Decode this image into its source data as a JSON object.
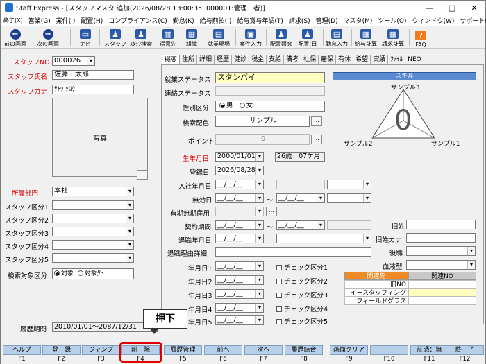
{
  "window": {
    "title": "Staff Express - [スタッフマスタ 追加(2026/08/28 13:00:35, 000001:管理　者)]",
    "minimize": "—",
    "maximize": "□",
    "close": "✕"
  },
  "menu": [
    "終了(X)",
    "営業(G)",
    "案件(J)",
    "配置(H)",
    "コンプライアンス(C)",
    "勤怠(K)",
    "給与前払(I)",
    "給与賞与年調(T)",
    "請求(S)",
    "管理(D)",
    "マスタ(M)",
    "ツール(O)",
    "ウィンドウ(W)",
    "サポート(H)"
  ],
  "toolbar": {
    "back": "前の画面",
    "forward": "次の画面",
    "navi": "ナビ",
    "staff": "スタッフ",
    "staff_search": "ｽﾀｯﾌ検索",
    "client": "得意先",
    "org": "組織",
    "site": "就業現場",
    "case_entry": "案件入力",
    "placement": "配置照会",
    "placement_day": "配置(日",
    "attendance": "勤怠入力",
    "pay_calc": "給与計算",
    "bill_calc": "請求計算",
    "faq": "FAQ"
  },
  "left": {
    "staff_no_label": "スタッフNO",
    "staff_no": "000026",
    "name_label": "スタッフ氏名",
    "name": "佐藤　太郎",
    "kana_label": "スタッフカナ",
    "kana": "ｻﾄｳ ｸﾛｳ",
    "photo": "写真",
    "photo_btn": "...",
    "dept_label": "所属部門",
    "dept": "本社",
    "class1": "スタッフ区分1",
    "class2": "スタッフ区分2",
    "class3": "スタッフ区分3",
    "class4": "スタッフ区分4",
    "class5": "スタッフ区分5",
    "search_label": "検索対象区分",
    "search_on": "対象",
    "search_off": "対象外",
    "history_label": "履歴期間",
    "history": "2010/01/01～2087/12/31"
  },
  "tabs": [
    "概要",
    "住所",
    "詳細",
    "経歴",
    "健診",
    "税金",
    "支給",
    "備考",
    "社保",
    "雇保",
    "有休",
    "希望",
    "実績",
    "ﾌｧｲﾙ",
    "NEO"
  ],
  "form": {
    "status_label": "就業ステータス",
    "status": "スタンバイ",
    "contact_label": "連絡ステータス",
    "gender_label": "性別区分",
    "male": "男",
    "female": "女",
    "color_label": "検索配色",
    "color_value": "サンプル",
    "color_btn": "...",
    "point_label": "ポイント",
    "point": "0",
    "point_btn": "...",
    "birth_label": "生年月日",
    "birth": "2000/01/01",
    "age": "26歳　07ケ月",
    "reg_label": "登録日",
    "reg": "2026/08/28",
    "hire_label": "入社年月日",
    "hire": "__/__/__",
    "invalid_label": "無効日",
    "invalid_from": "__/__/__",
    "tilde": "～",
    "invalid_to": "__/__/__",
    "indef_label": "有期無期雇用",
    "indef_btn": "...",
    "contract_label": "契約期間",
    "contract_from": "__/__/__",
    "contract_to": "__/__/__",
    "retire_label": "退職年月日",
    "retire": "__/__/__",
    "retire_reason_label": "退職理由詳細",
    "date1": "年月日1",
    "date2": "年月日2",
    "date3": "年月日3",
    "date4": "年月日4",
    "date5": "年月日5",
    "empty_date": "__/__/__",
    "check1": "チェック区分1",
    "check2": "チェック区分2",
    "check3": "チェック区分3",
    "check4": "チェック区分4",
    "check5": "チェック区分5",
    "old_name_label": "旧姓",
    "old_kana_label": "旧姓カナ",
    "role_label": "役職",
    "blood_label": "血液型"
  },
  "skill": {
    "header": "スキル",
    "s1": "サンプル1",
    "s2": "サンプル2",
    "s3": "サンプル3",
    "center": "0"
  },
  "relation": {
    "col1": "関連先",
    "col2": "関連NO",
    "rows": [
      "旧NO",
      "イースタッフィング",
      "フィールドグラス"
    ]
  },
  "callout": "押下",
  "fkeys": [
    {
      "label": "ヘルプ",
      "key": "F1"
    },
    {
      "label": "登　録",
      "key": "F2"
    },
    {
      "label": "ジャンプ",
      "key": "F3"
    },
    {
      "label": "削　除",
      "key": "F4"
    },
    {
      "label": "履歴管理",
      "key": "F5"
    },
    {
      "label": "前へ",
      "key": "F6"
    },
    {
      "label": "次へ",
      "key": "F7"
    },
    {
      "label": "履歴結合",
      "key": "F8"
    },
    {
      "label": "画面クリア",
      "key": "F9"
    },
    {
      "label": "",
      "key": "F10"
    },
    {
      "label": "証憑：無",
      "key": "F11"
    },
    {
      "label": "終　了",
      "key": "F12"
    }
  ],
  "colors": {
    "fkey_bg": "#b7cfe8",
    "highlight": "#e00000",
    "status_bg": "#ffffc0",
    "skill_bar": "#5a8ad0",
    "relation_header": "#f08a24"
  }
}
